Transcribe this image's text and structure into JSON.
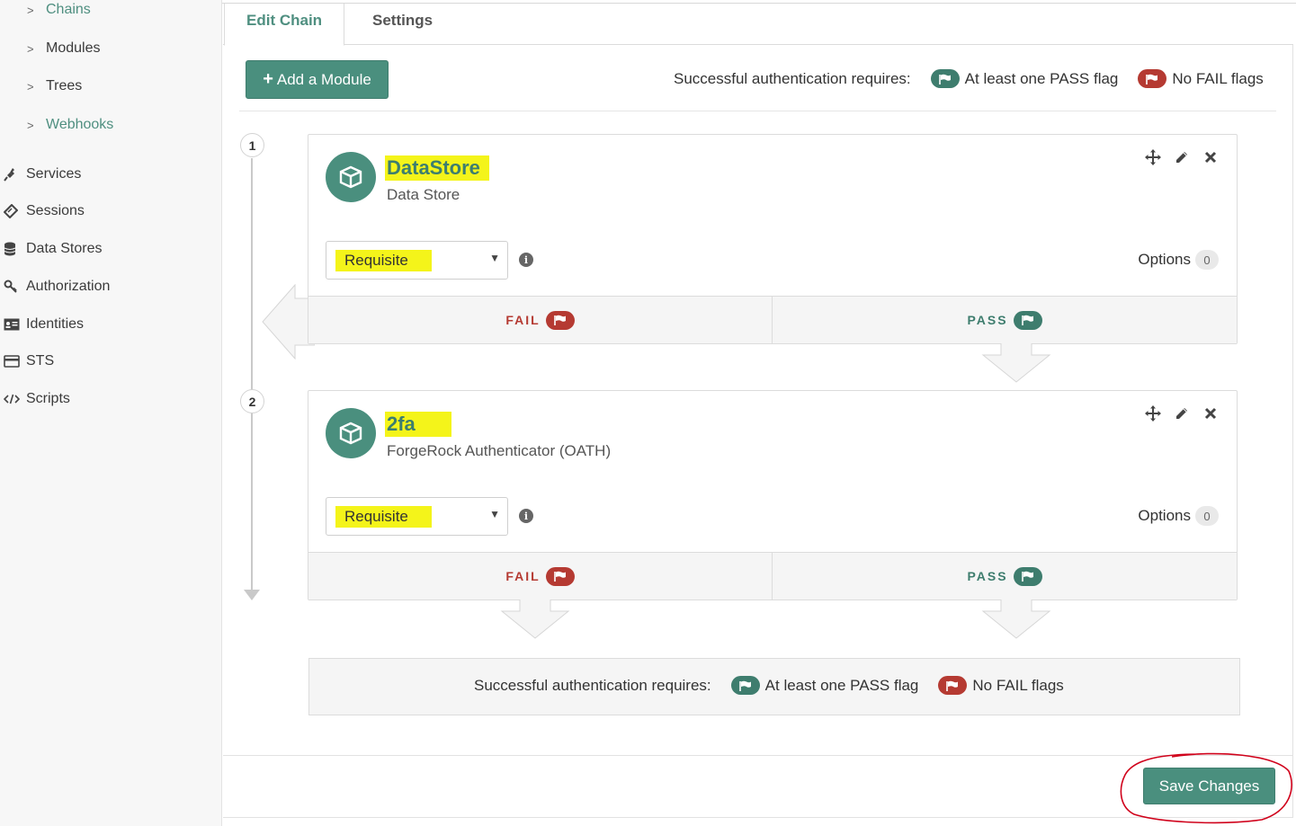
{
  "sidebar": {
    "sub_items": [
      {
        "label": "Chains",
        "active": true
      },
      {
        "label": "Modules",
        "active": false
      },
      {
        "label": "Trees",
        "active": false
      },
      {
        "label": "Webhooks",
        "active": true
      }
    ],
    "nav_items": [
      {
        "label": "Services",
        "icon": "plug-icon"
      },
      {
        "label": "Sessions",
        "icon": "ticket-icon"
      },
      {
        "label": "Data Stores",
        "icon": "database-icon"
      },
      {
        "label": "Authorization",
        "icon": "key-icon"
      },
      {
        "label": "Identities",
        "icon": "id-card-icon"
      },
      {
        "label": "STS",
        "icon": "credit-card-icon"
      },
      {
        "label": "Scripts",
        "icon": "code-icon"
      }
    ]
  },
  "tabs": [
    {
      "label": "Edit Chain",
      "active": true
    },
    {
      "label": "Settings",
      "active": false
    }
  ],
  "toolbar": {
    "add_module_label": "Add a Module"
  },
  "requirements": {
    "prefix": "Successful authentication requires:",
    "pass_text": "At least one PASS flag",
    "fail_text": "No FAIL flags"
  },
  "modules": [
    {
      "index": "1",
      "name": "DataStore",
      "type": "Data Store",
      "criteria": "Requisite",
      "options_label": "Options",
      "options_count": "0",
      "fail_label": "FAIL",
      "pass_label": "PASS"
    },
    {
      "index": "2",
      "name": "2fa",
      "type": "ForgeRock Authenticator (OATH)",
      "criteria": "Requisite",
      "options_label": "Options",
      "options_count": "0",
      "fail_label": "FAIL",
      "pass_label": "PASS"
    }
  ],
  "footer": {
    "save_label": "Save Changes"
  },
  "colors": {
    "accent": "#4a8f7e",
    "pass": "#3e7d6e",
    "fail": "#b53a32",
    "highlight": "#f4f41a",
    "annotation": "#d0021b"
  }
}
